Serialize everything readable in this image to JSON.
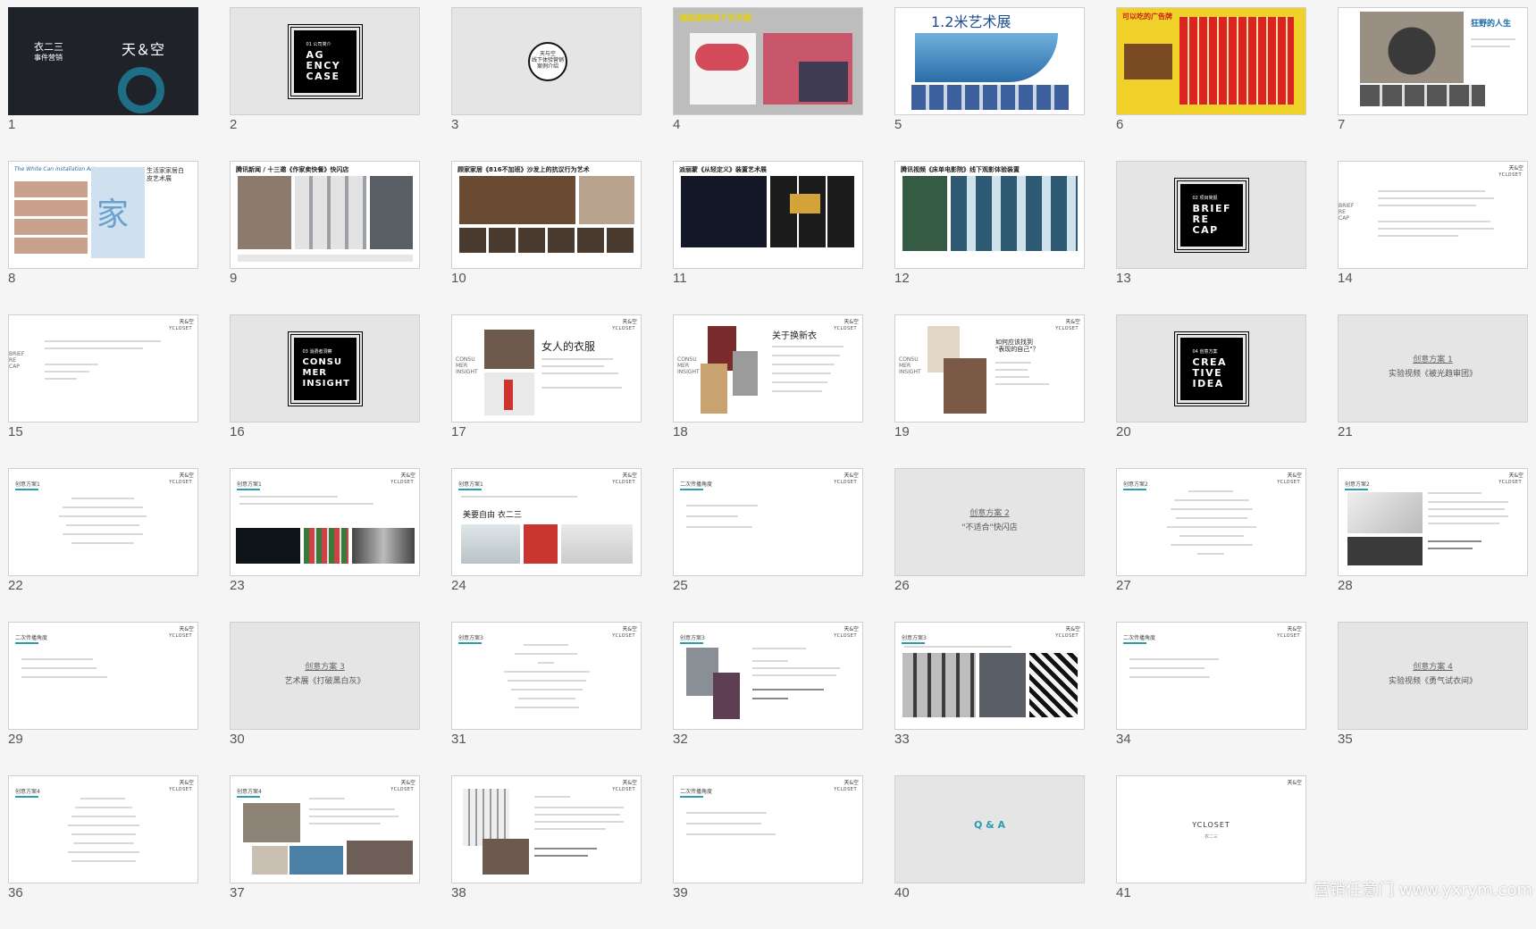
{
  "colors": {
    "background": "#f5f5f5",
    "accent": "#2a9db0",
    "dark_slide": "#1f2228"
  },
  "slides": [
    {
      "n": "1",
      "left_text": "衣二三",
      "left_sub": "事件营销",
      "right_text": "天＆空"
    },
    {
      "n": "2",
      "small": "01 公司简介",
      "big": "AG\nENCY\nCASE"
    },
    {
      "n": "3",
      "circle": "天与空\n线下体验营销\n案例介绍"
    },
    {
      "n": "4",
      "title": "海街家的地下艺术展"
    },
    {
      "n": "5",
      "title": "1.2米艺术展"
    },
    {
      "n": "6",
      "title": "可以吃的广告牌"
    },
    {
      "n": "7",
      "title": "狂野的人生"
    },
    {
      "n": "8",
      "title": "The White Can installation Art",
      "side": "生活家家居白皮艺术展"
    },
    {
      "n": "9",
      "title": "腾讯新闻 / 十三邀《作家卖快餐》快闪店"
    },
    {
      "n": "10",
      "title": "顾家家居《816不加班》沙发上的抗议行为艺术"
    },
    {
      "n": "11",
      "title": "派丽蒙《从轻定义》装置艺术展"
    },
    {
      "n": "12",
      "title": "腾讯视频《床单电影院》线下观影体验装置"
    },
    {
      "n": "13",
      "small": "02 项目简报",
      "big": "BRIEF\nRE\nCAP"
    },
    {
      "n": "14",
      "side": "BRIEF\nRE\nCAP"
    },
    {
      "n": "15",
      "side": "BRIEF\nRE\nCAP"
    },
    {
      "n": "16",
      "small": "03 消费者洞察",
      "big": "CONSU\nMER\nINSIGHT"
    },
    {
      "n": "17",
      "heading": "女人的衣服",
      "side": "CONSU\nMER\nINSIGHT"
    },
    {
      "n": "18",
      "heading": "关于换新衣",
      "side": "CONSU\nMER\nINSIGHT"
    },
    {
      "n": "19",
      "heading": "如何应该找到\n\"表现的自己\"？",
      "side": "CONSU\nMER\nINSIGHT"
    },
    {
      "n": "20",
      "small": "04 创意方案",
      "big": "CREA\nTIVE\nIDEA"
    },
    {
      "n": "21",
      "link": "创意方案 1",
      "sub": "实验视频《被光趋审团》"
    },
    {
      "n": "22",
      "hdr": "创意方案1"
    },
    {
      "n": "23",
      "hdr": "创意方案1"
    },
    {
      "n": "24",
      "hdr": "创意方案1",
      "caption": "美要自由 衣二三"
    },
    {
      "n": "25",
      "hdr": "二次传播角度"
    },
    {
      "n": "26",
      "link": "创意方案 2",
      "sub": "\"不适合\"快闪店"
    },
    {
      "n": "27",
      "hdr": "创意方案2"
    },
    {
      "n": "28",
      "hdr": "创意方案2"
    },
    {
      "n": "29",
      "hdr": "二次传播角度"
    },
    {
      "n": "30",
      "link": "创意方案 3",
      "sub": "艺术展《打破黑白灰》"
    },
    {
      "n": "31",
      "hdr": "创意方案3"
    },
    {
      "n": "32",
      "hdr": "创意方案3"
    },
    {
      "n": "33",
      "hdr": "创意方案3"
    },
    {
      "n": "34",
      "hdr": "二次传播角度"
    },
    {
      "n": "35",
      "link": "创意方案 4",
      "sub": "实验视频《勇气试衣间》"
    },
    {
      "n": "36",
      "hdr": "创意方案4"
    },
    {
      "n": "37",
      "hdr": "创意方案4"
    },
    {
      "n": "38",
      "hdr": "创意方案4"
    },
    {
      "n": "39",
      "hdr": "二次传播角度"
    },
    {
      "n": "40",
      "qa": "Q & A"
    },
    {
      "n": "41",
      "logo": "YCLOSET",
      "logo_sub": "衣二三"
    }
  ],
  "brand_tag": "天&空",
  "yc_tag": "YCLOSET",
  "watermark": "营销任意门 www.yxrym.com"
}
